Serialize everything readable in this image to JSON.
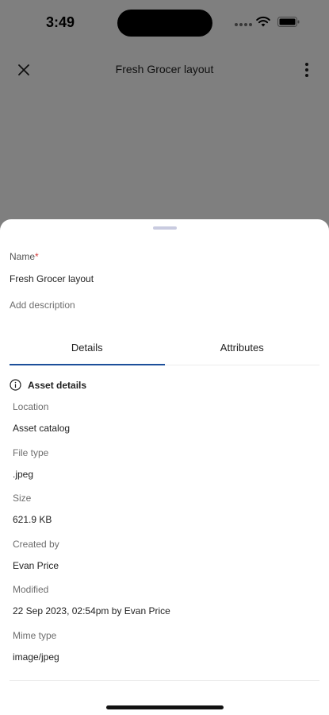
{
  "status_bar": {
    "time": "3:49"
  },
  "app_bar": {
    "title": "Fresh Grocer layout"
  },
  "sheet": {
    "name_label": "Name",
    "required_mark": "*",
    "name_value": "Fresh Grocer layout",
    "description_placeholder": "Add description",
    "tabs": [
      {
        "label": "Details",
        "active": true
      },
      {
        "label": "Attributes",
        "active": false
      }
    ],
    "section_title": "Asset details",
    "details": [
      {
        "label": "Location",
        "value": "Asset catalog"
      },
      {
        "label": "File type",
        "value": ".jpeg"
      },
      {
        "label": "Size",
        "value": "621.9 KB"
      },
      {
        "label": "Created by",
        "value": "Evan Price"
      },
      {
        "label": "Modified",
        "value": "22 Sep 2023, 02:54pm by Evan Price"
      },
      {
        "label": "Mime type",
        "value": "image/jpeg"
      }
    ]
  },
  "icons": {
    "close": "close-icon",
    "more": "more-vertical-icon",
    "info": "info-icon",
    "wifi": "wifi-icon",
    "battery": "battery-icon"
  },
  "colors": {
    "tab_indicator": "#1c4f9a",
    "required": "#d43b3b",
    "scrim": "rgba(0,0,0,0.5)"
  }
}
